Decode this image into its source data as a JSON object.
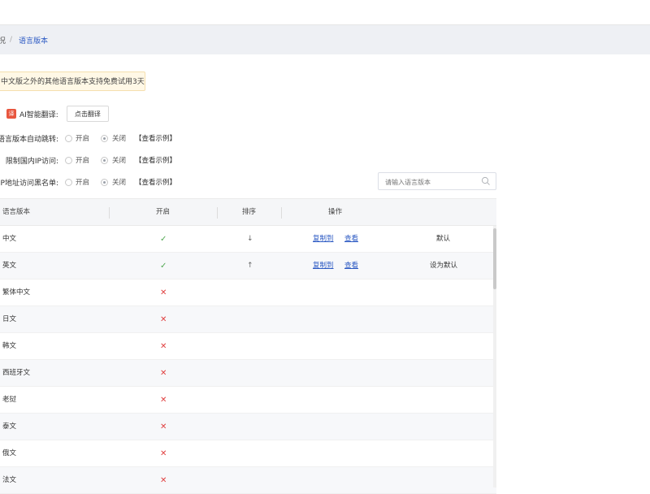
{
  "breadcrumb": {
    "prev": "况",
    "separator": "/",
    "current": "语言版本"
  },
  "notice": {
    "text": "中文版之外的其他语言版本支持免费试用3天"
  },
  "ai": {
    "icon": "ai-translate-icon",
    "icon_glyph": "译",
    "label": "AI智能翻译:",
    "button": "点击翻译"
  },
  "options": [
    {
      "label": "语言版本自动跳转:",
      "on": "开启",
      "off": "关闭",
      "selected": "off",
      "example": "【查看示例】"
    },
    {
      "label": "限制国内IP访问:",
      "on": "开启",
      "off": "关闭",
      "selected": "off",
      "example": "【查看示例】"
    },
    {
      "label": "IP地址访问黑名单:",
      "on": "开启",
      "off": "关闭",
      "selected": "off",
      "example": "【查看示例】"
    }
  ],
  "search": {
    "placeholder": "请输入语言版本",
    "icon": "search-icon"
  },
  "table": {
    "headers": {
      "language": "语言版本",
      "enabled": "开启",
      "sort": "排序",
      "actions": "操作"
    },
    "rows": [
      {
        "language": "中文",
        "enabled": "✓",
        "sort": "↓",
        "copy": "复制到",
        "view": "查看",
        "default": "默认"
      },
      {
        "language": "英文",
        "enabled": "✓",
        "sort": "↑",
        "copy": "复制到",
        "view": "查看",
        "default": "设为默认"
      },
      {
        "language": "繁体中文",
        "enabled": "✕"
      },
      {
        "language": "日文",
        "enabled": "✕"
      },
      {
        "language": "韩文",
        "enabled": "✕"
      },
      {
        "language": "西班牙文",
        "enabled": "✕"
      },
      {
        "language": "老挝",
        "enabled": "✕"
      },
      {
        "language": "泰文",
        "enabled": "✕"
      },
      {
        "language": "俄文",
        "enabled": "✕"
      },
      {
        "language": "法文",
        "enabled": "✕"
      }
    ]
  },
  "colors": {
    "link": "#2b59c3",
    "check": "#52a852",
    "cross": "#e04040",
    "notice_bg": "#fff8e6"
  }
}
